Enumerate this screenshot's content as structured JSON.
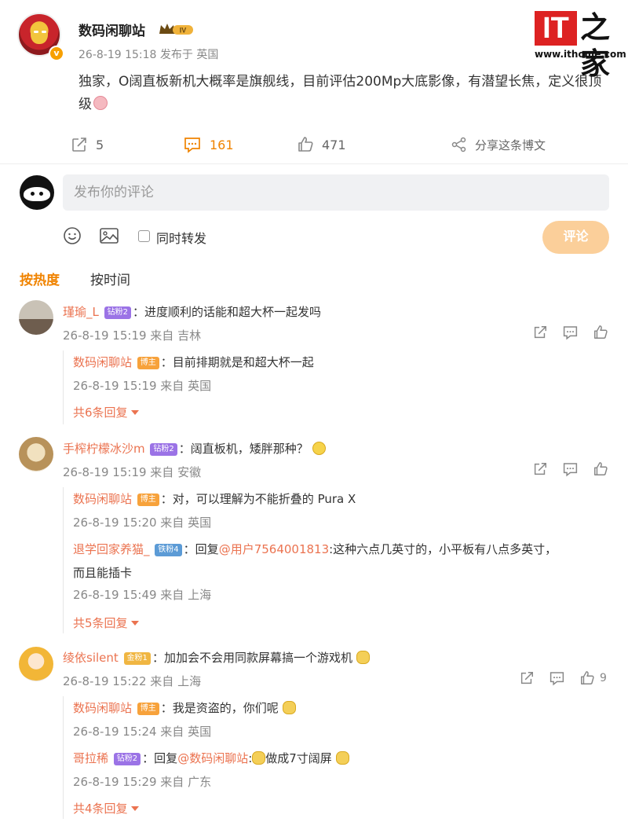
{
  "post": {
    "author": "数码闲聊站",
    "level_badge": "IV",
    "time": "26-8-19 15:18",
    "posted_from": "发布于 英国",
    "text": "独家，O阔直板新机大概率是旗舰线，目前评估200Mp大底影像，有潜望长焦，定义很顶级"
  },
  "logo": {
    "it": "IT",
    "zh": "之家",
    "url": "www.ithome.com"
  },
  "actions": {
    "repost_count": "5",
    "comment_count": "161",
    "like_count": "471",
    "share_label": "分享这条博文"
  },
  "compose": {
    "placeholder": "发布你的评论",
    "also_repost_label": "同时转发",
    "submit_label": "评论"
  },
  "tabs": {
    "hot": "按热度",
    "time": "按时间"
  },
  "comments": [
    {
      "name": "瑾瑜_L",
      "badge": "钻粉2",
      "text": "：进度顺利的话能和超大杯一起发吗",
      "time": "26-8-19 15:19 来自 吉林",
      "replies": [
        {
          "name": "数码闲聊站",
          "badge": "博主",
          "text": "：目前排期就是和超大杯一起",
          "time": "26-8-19 15:19 来自 英国"
        }
      ],
      "more": "共6条回复"
    },
    {
      "name": "手榨柠檬冰沙m",
      "badge": "钻粉2",
      "text": "：阔直板机，矮胖那种？",
      "time": "26-8-19 15:19 来自 安徽",
      "replies": [
        {
          "name": "数码闲聊站",
          "badge": "博主",
          "text": "：对，可以理解为不能折叠的 Pura X",
          "time": "26-8-19 15:20 来自 英国"
        },
        {
          "name": "退学回家养猫_",
          "badge": "铁粉4",
          "prefix": "：回复",
          "mention": "@用户7564001813",
          "text": ":这种六点几英寸的，小平板有八点多英寸，",
          "text2": "而且能插卡",
          "time": "26-8-19 15:49 来自 上海"
        }
      ],
      "more": "共5条回复"
    },
    {
      "name": "绫依silent",
      "badge": "金粉1",
      "text": "：加加会不会用同款屏幕搞一个游戏机",
      "time": "26-8-19 15:22 来自 上海",
      "like_count": "9",
      "replies": [
        {
          "name": "数码闲聊站",
          "badge": "博主",
          "text": "：我是资盗的，你们呢",
          "time": "26-8-19 15:24 来自 英国"
        },
        {
          "name": "哥拉稀",
          "badge": "钻粉2",
          "prefix": "：回复",
          "mention": "@数码闲聊站",
          "text": "做成7寸阔屏",
          "time": "26-8-19 15:29 来自 广东"
        }
      ],
      "more": "共4条回复"
    }
  ]
}
